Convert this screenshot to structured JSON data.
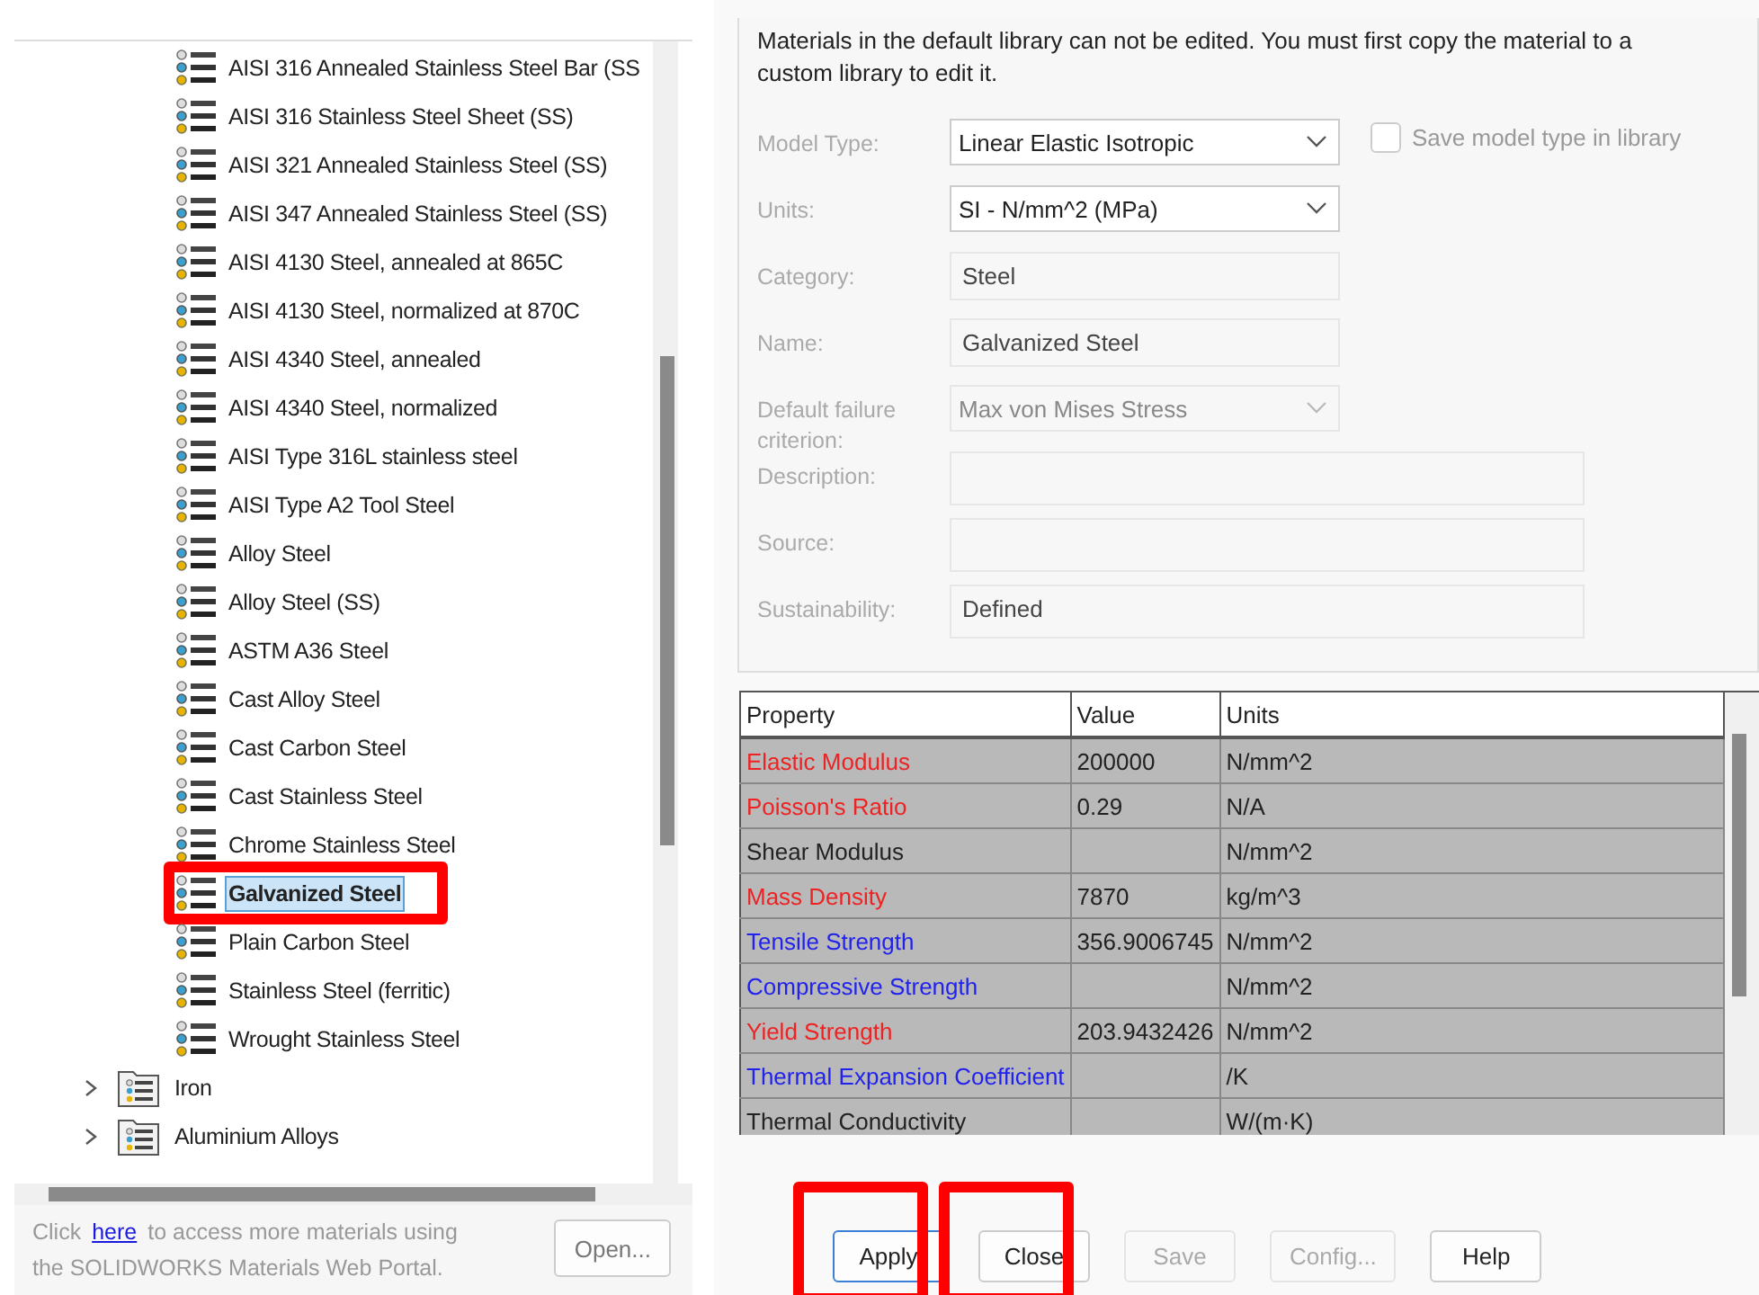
{
  "tree": {
    "items": [
      {
        "label": "AISI 316 Annealed Stainless Steel Bar (SS",
        "kind": "material",
        "selected": false,
        "annotated": false
      },
      {
        "label": "AISI 316 Stainless Steel Sheet (SS)",
        "kind": "material",
        "selected": false,
        "annotated": false
      },
      {
        "label": "AISI 321 Annealed Stainless Steel (SS)",
        "kind": "material",
        "selected": false,
        "annotated": false
      },
      {
        "label": "AISI 347 Annealed Stainless Steel (SS)",
        "kind": "material",
        "selected": false,
        "annotated": false
      },
      {
        "label": "AISI 4130 Steel, annealed at 865C",
        "kind": "material",
        "selected": false,
        "annotated": false
      },
      {
        "label": "AISI 4130 Steel, normalized at 870C",
        "kind": "material",
        "selected": false,
        "annotated": false
      },
      {
        "label": "AISI 4340 Steel, annealed",
        "kind": "material",
        "selected": false,
        "annotated": false
      },
      {
        "label": "AISI 4340 Steel, normalized",
        "kind": "material",
        "selected": false,
        "annotated": false
      },
      {
        "label": "AISI Type 316L stainless steel",
        "kind": "material",
        "selected": false,
        "annotated": false
      },
      {
        "label": "AISI Type A2 Tool Steel",
        "kind": "material",
        "selected": false,
        "annotated": false
      },
      {
        "label": "Alloy Steel",
        "kind": "material",
        "selected": false,
        "annotated": false
      },
      {
        "label": "Alloy Steel (SS)",
        "kind": "material",
        "selected": false,
        "annotated": false
      },
      {
        "label": "ASTM A36 Steel",
        "kind": "material",
        "selected": false,
        "annotated": false
      },
      {
        "label": "Cast Alloy Steel",
        "kind": "material",
        "selected": false,
        "annotated": false
      },
      {
        "label": "Cast Carbon Steel",
        "kind": "material",
        "selected": false,
        "annotated": false
      },
      {
        "label": "Cast Stainless Steel",
        "kind": "material",
        "selected": false,
        "annotated": false
      },
      {
        "label": "Chrome Stainless Steel",
        "kind": "material",
        "selected": false,
        "annotated": false
      },
      {
        "label": "Galvanized Steel",
        "kind": "material",
        "selected": true,
        "annotated": true
      },
      {
        "label": "Plain Carbon Steel",
        "kind": "material",
        "selected": false,
        "annotated": false
      },
      {
        "label": "Stainless Steel (ferritic)",
        "kind": "material",
        "selected": false,
        "annotated": false
      },
      {
        "label": "Wrought Stainless Steel",
        "kind": "material",
        "selected": false,
        "annotated": false
      },
      {
        "label": "Iron",
        "kind": "folder",
        "expanded": false,
        "selected": false,
        "annotated": false
      },
      {
        "label": "Aluminium Alloys",
        "kind": "folder",
        "expanded": false,
        "selected": false,
        "annotated": false
      }
    ]
  },
  "portal_note": {
    "before": "Click",
    "link": "here",
    "after": "to access more materials using",
    "line2": "the SOLIDWORKS Materials Web Portal."
  },
  "open_button": {
    "label": "Open...",
    "disabled": false
  },
  "notice": "Materials in the default library can not be edited. You must first copy the material to a custom library to edit it.",
  "form": [
    {
      "label": "Model Type:",
      "kind": "dropdown",
      "value": "Linear Elastic Isotropic",
      "disabled": false
    },
    {
      "label": "Units:",
      "kind": "dropdown",
      "value": "SI - N/mm^2 (MPa)",
      "disabled": false
    },
    {
      "label": "Category:",
      "kind": "text",
      "value": "Steel",
      "wide": false
    },
    {
      "label": "Name:",
      "kind": "text",
      "value": "Galvanized Steel",
      "wide": false
    },
    {
      "label": "Default failure criterion:",
      "kind": "dropdown",
      "value": "Max von Mises Stress",
      "disabled": true
    },
    {
      "label": "Description:",
      "kind": "text",
      "wide": true
    },
    {
      "label": "Source:",
      "kind": "text",
      "wide": true
    },
    {
      "label": "Sustainability:",
      "kind": "text",
      "value": "Defined",
      "wide": true
    }
  ],
  "save_model_type": {
    "label": "Save model type in library",
    "checked": false
  },
  "table": {
    "columns": [
      "Property",
      "Value",
      "Units"
    ],
    "rows": [
      {
        "property": "Elastic Modulus",
        "color": "#ee2222",
        "value": "200000",
        "units": "N/mm^2"
      },
      {
        "property": "Poisson's Ratio",
        "color": "#ee2222",
        "value": "0.29",
        "units": "N/A"
      },
      {
        "property": "Shear Modulus",
        "color": "#222222",
        "units": "N/mm^2"
      },
      {
        "property": "Mass Density",
        "color": "#ee2222",
        "value": "7870",
        "units": "kg/m^3"
      },
      {
        "property": "Tensile Strength",
        "color": "#2222ee",
        "value": "356.9006745",
        "units": "N/mm^2"
      },
      {
        "property": "Compressive Strength",
        "color": "#2222ee",
        "units": "N/mm^2"
      },
      {
        "property": "Yield Strength",
        "color": "#ee2222",
        "value": "203.9432426",
        "units": "N/mm^2"
      },
      {
        "property": "Thermal Expansion Coefficient",
        "color": "#2222ee",
        "units": "/K"
      },
      {
        "property": "Thermal Conductivity",
        "color": "#222222",
        "units": "W/(m·K)"
      }
    ]
  },
  "buttons": [
    {
      "label": "Apply",
      "disabled": false,
      "focused": true,
      "annotated": true
    },
    {
      "label": "Close",
      "disabled": false,
      "focused": false,
      "annotated": true
    },
    {
      "label": "Save",
      "disabled": true,
      "focused": false,
      "annotated": false
    },
    {
      "label": "Config...",
      "disabled": true,
      "focused": false,
      "annotated": false
    },
    {
      "label": "Help",
      "disabled": false,
      "focused": false,
      "annotated": false
    }
  ]
}
